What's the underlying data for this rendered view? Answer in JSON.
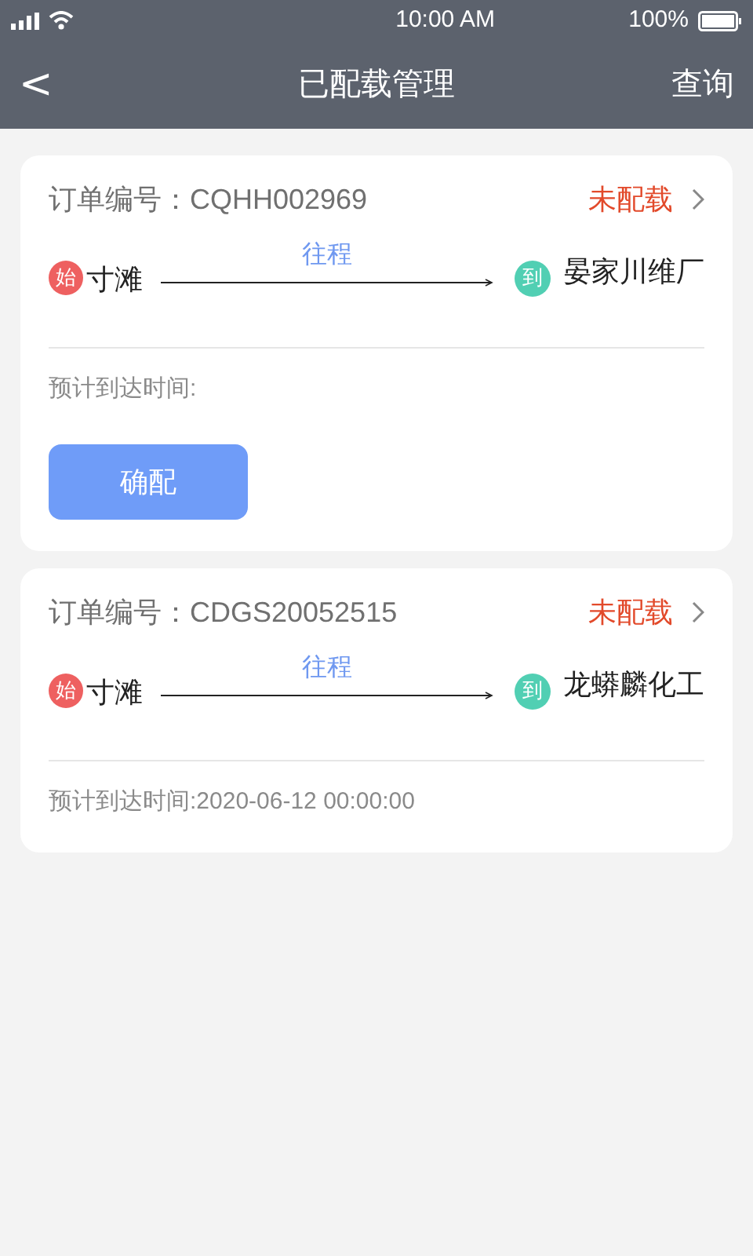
{
  "status_bar": {
    "time": "10:00 AM",
    "battery": "100%"
  },
  "nav_bar": {
    "back": "<",
    "title": "已配载管理",
    "action": "查询"
  },
  "orders": [
    {
      "order_no": "订单编号：CQHH002969",
      "status": "未配载",
      "start_badge": "始",
      "start": "寸滩",
      "trip": "往程",
      "end_badge": "到",
      "end": "晏家川维厂",
      "eta": "预计到达时间:",
      "button": "确配"
    },
    {
      "order_no": "订单编号：CDGS20052515",
      "status": "未配载",
      "start_badge": "始",
      "start": "寸滩",
      "trip": "往程",
      "end_badge": "到",
      "end": "龙蟒麟化工",
      "eta": "预计到达时间:2020-06-12 00:00:00"
    }
  ]
}
